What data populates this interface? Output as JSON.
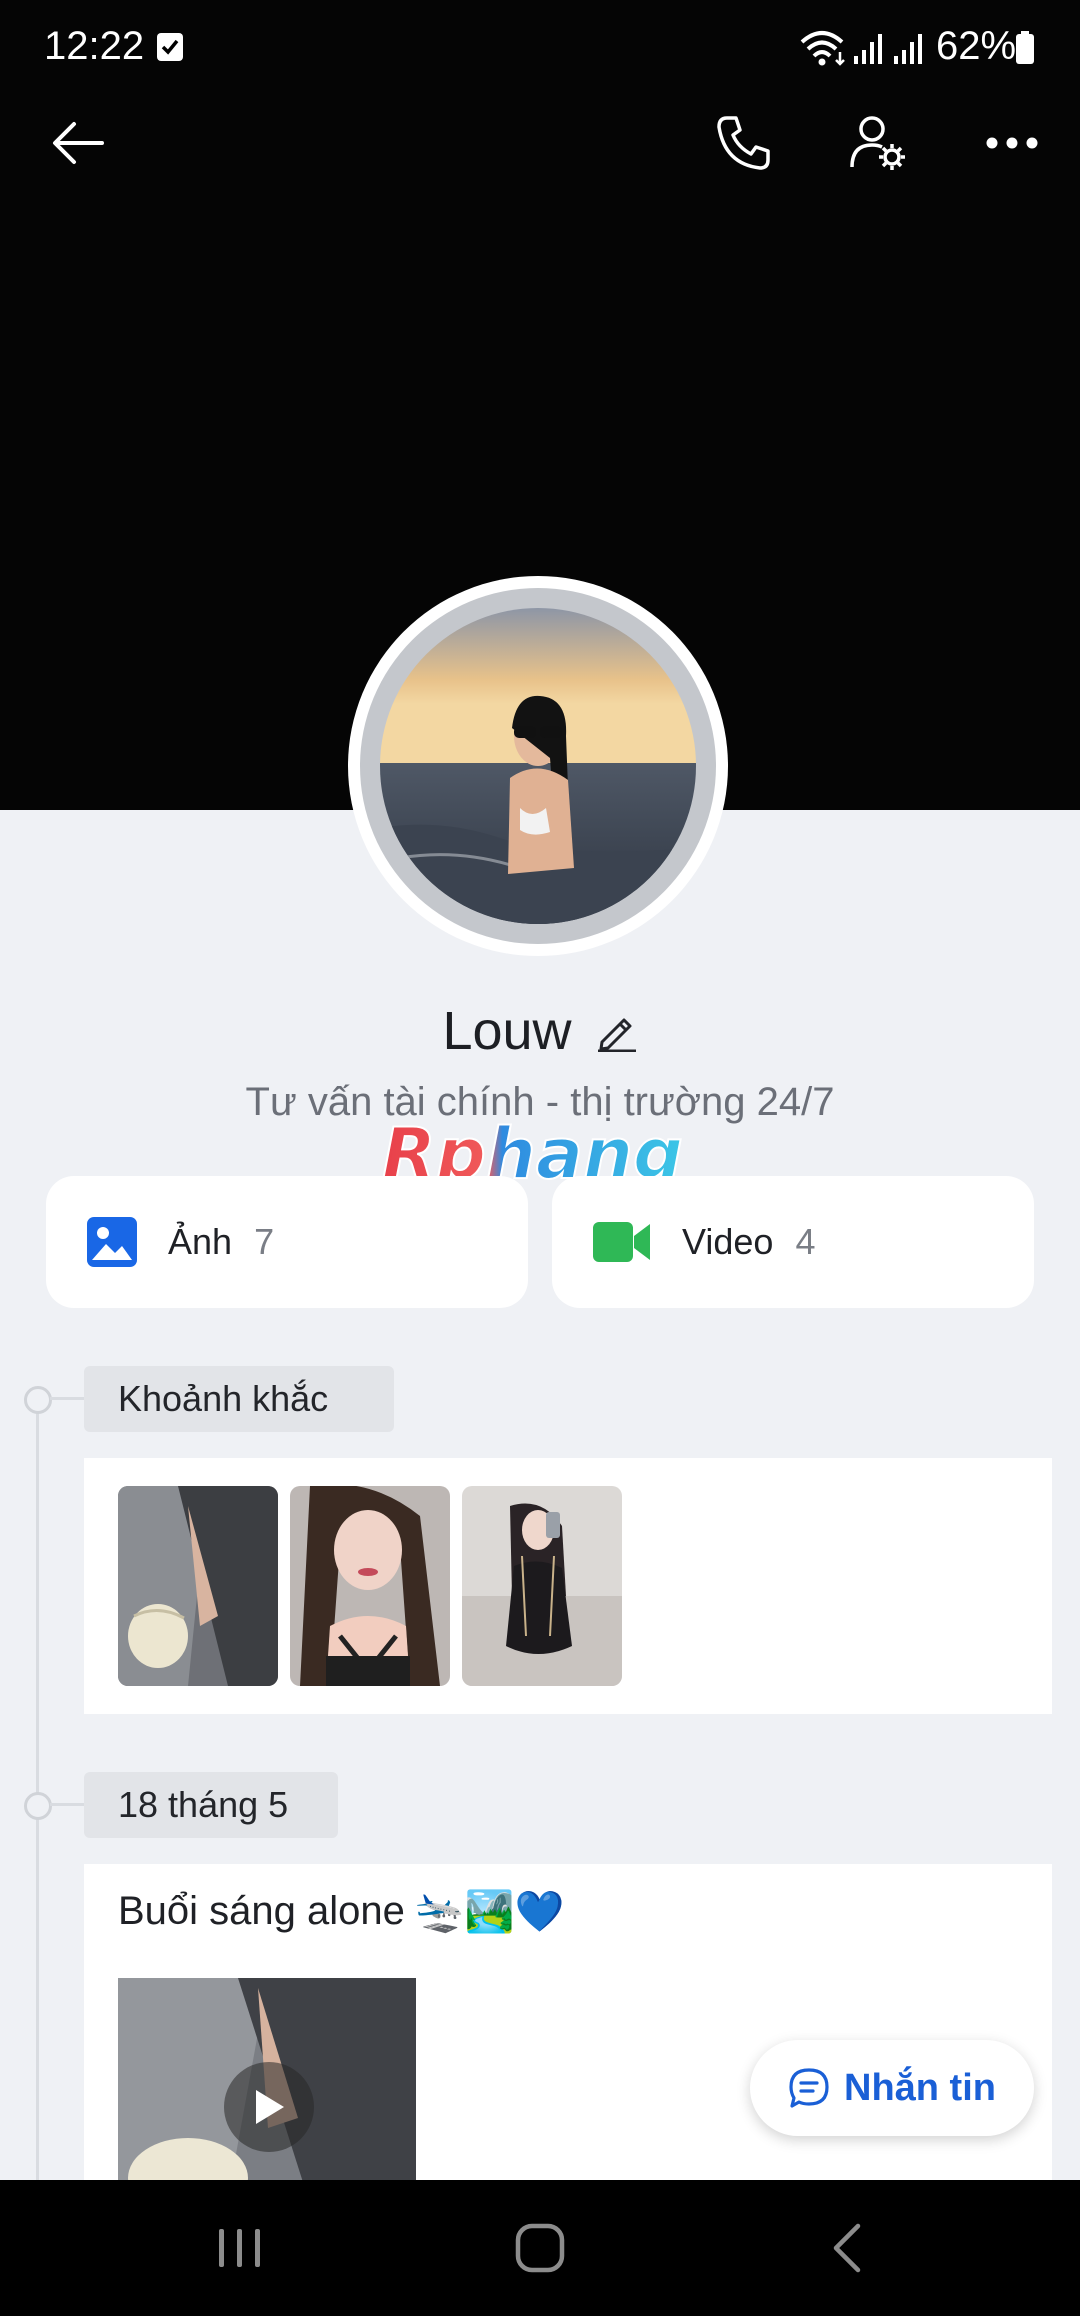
{
  "status_bar": {
    "time": "12:22",
    "battery": "62%"
  },
  "profile": {
    "name": "Louw",
    "bio": "Tư vấn tài chính - thị trường 24/7"
  },
  "watermark": "Rphang",
  "media": {
    "photos": {
      "label": "Ảnh",
      "count": "7"
    },
    "videos": {
      "label": "Video",
      "count": "4"
    }
  },
  "timeline": {
    "moments_label": "Khoảnh khắc",
    "date_label": "18 tháng 5",
    "post_text": "Buổi sáng alone",
    "post_emojis": "🛬🏞️💙"
  },
  "message_button": "Nhắn tin",
  "colors": {
    "accent": "#1a5fd6",
    "photo_icon": "#1967e6",
    "video_icon": "#2fb856"
  }
}
